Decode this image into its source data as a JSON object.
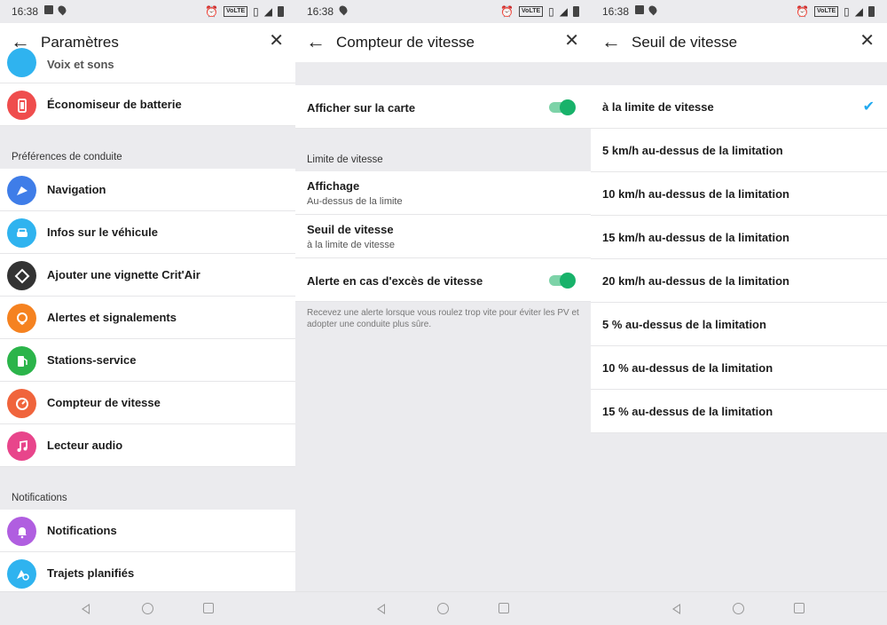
{
  "status": {
    "time": "16:38",
    "volte": "VoLTE"
  },
  "screen1": {
    "title": "Paramètres",
    "partial_item": "Voix et sons",
    "battery_item": "Économiseur de batterie",
    "section_driving": "Préférences de conduite",
    "driving_items": [
      {
        "label": "Navigation",
        "icon": "navigation-icon",
        "color": "#3f7de8"
      },
      {
        "label": "Infos sur le véhicule",
        "icon": "car-icon",
        "color": "#2fb3ef"
      },
      {
        "label": "Ajouter une vignette Crit'Air",
        "icon": "critair-icon",
        "color": "#333333"
      },
      {
        "label": "Alertes et signalements",
        "icon": "alert-icon",
        "color": "#f58220"
      },
      {
        "label": "Stations-service",
        "icon": "fuel-icon",
        "color": "#2bb44a"
      },
      {
        "label": "Compteur de vitesse",
        "icon": "speedometer-icon",
        "color": "#f0643c"
      },
      {
        "label": "Lecteur audio",
        "icon": "music-icon",
        "color": "#e8458b"
      }
    ],
    "section_notifications": "Notifications",
    "notification_items": [
      {
        "label": "Notifications",
        "icon": "bell-icon",
        "color": "#b05ee0"
      },
      {
        "label": "Trajets planifiés",
        "icon": "planned-trips-icon",
        "color": "#2fb3ef"
      }
    ],
    "battery_color": "#ef4d4d"
  },
  "screen2": {
    "title": "Compteur de vitesse",
    "show_on_map": "Afficher sur la carte",
    "show_on_map_on": true,
    "section_limit": "Limite de vitesse",
    "display_label": "Affichage",
    "display_value": "Au-dessus de la limite",
    "threshold_label": "Seuil de vitesse",
    "threshold_value": "à la limite de vitesse",
    "alert_label": "Alerte en cas d'excès de vitesse",
    "alert_on": true,
    "hint": "Recevez une alerte lorsque vous roulez trop vite pour éviter les PV et adopter une conduite plus sûre."
  },
  "screen3": {
    "title": "Seuil de vitesse",
    "options": [
      "à la limite de vitesse",
      "5 km/h au-dessus de la limitation",
      "10 km/h au-dessus de la limitation",
      "15 km/h au-dessus de la limitation",
      "20 km/h au-dessus de la limitation",
      "5 % au-dessus de la limitation",
      "10 % au-dessus de la limitation",
      "15 % au-dessus de la limitation"
    ],
    "selected_index": 0
  }
}
